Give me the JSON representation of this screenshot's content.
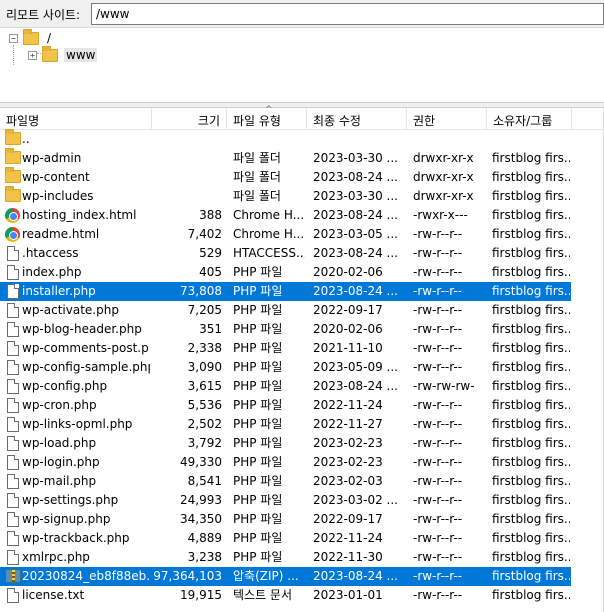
{
  "sitebar": {
    "label": "리모트 사이트:",
    "path": "/www"
  },
  "tree": {
    "root": {
      "label": "/",
      "expander": "−"
    },
    "child": {
      "label": "www",
      "expander": "+"
    }
  },
  "columns": [
    "파일명",
    "크기",
    "파일 유형",
    "최종 수정",
    "권한",
    "소유자/그룹"
  ],
  "rows": [
    {
      "icon": "folder-icon",
      "name": "..",
      "size": "",
      "type": "",
      "date": "",
      "perm": "",
      "owner": ""
    },
    {
      "icon": "folder-icon",
      "name": "wp-admin",
      "size": "",
      "type": "파일 폴더",
      "date": "2023-03-30 ...",
      "perm": "drwxr-xr-x",
      "owner": "firstblog firs..."
    },
    {
      "icon": "folder-icon",
      "name": "wp-content",
      "size": "",
      "type": "파일 폴더",
      "date": "2023-08-24 ...",
      "perm": "drwxr-xr-x",
      "owner": "firstblog firs..."
    },
    {
      "icon": "folder-icon",
      "name": "wp-includes",
      "size": "",
      "type": "파일 폴더",
      "date": "2023-03-30 ...",
      "perm": "drwxr-xr-x",
      "owner": "firstblog firs..."
    },
    {
      "icon": "chrome-icon",
      "name": "hosting_index.html",
      "size": "388",
      "type": "Chrome H...",
      "date": "2023-08-24 ...",
      "perm": "-rwxr-x---",
      "owner": "firstblog firs..."
    },
    {
      "icon": "chrome-icon",
      "name": "readme.html",
      "size": "7,402",
      "type": "Chrome H...",
      "date": "2023-03-05 ...",
      "perm": "-rw-r--r--",
      "owner": "firstblog firs..."
    },
    {
      "icon": "file-icon",
      "name": ".htaccess",
      "size": "529",
      "type": "HTACCESS...",
      "date": "2023-08-24 ...",
      "perm": "-rw-r--r--",
      "owner": "firstblog firs..."
    },
    {
      "icon": "file-icon",
      "name": "index.php",
      "size": "405",
      "type": "PHP 파일",
      "date": "2020-02-06",
      "perm": "-rw-r--r--",
      "owner": "firstblog firs..."
    },
    {
      "icon": "file-icon",
      "name": "installer.php",
      "size": "73,808",
      "type": "PHP 파일",
      "date": "2023-08-24 ...",
      "perm": "-rw-r--r--",
      "owner": "firstblog firs...",
      "selected": true
    },
    {
      "icon": "file-icon",
      "name": "wp-activate.php",
      "size": "7,205",
      "type": "PHP 파일",
      "date": "2022-09-17",
      "perm": "-rw-r--r--",
      "owner": "firstblog firs..."
    },
    {
      "icon": "file-icon",
      "name": "wp-blog-header.php",
      "size": "351",
      "type": "PHP 파일",
      "date": "2020-02-06",
      "perm": "-rw-r--r--",
      "owner": "firstblog firs..."
    },
    {
      "icon": "file-icon",
      "name": "wp-comments-post.p...",
      "size": "2,338",
      "type": "PHP 파일",
      "date": "2021-11-10",
      "perm": "-rw-r--r--",
      "owner": "firstblog firs..."
    },
    {
      "icon": "file-icon",
      "name": "wp-config-sample.php",
      "size": "3,090",
      "type": "PHP 파일",
      "date": "2023-05-09 ...",
      "perm": "-rw-r--r--",
      "owner": "firstblog firs..."
    },
    {
      "icon": "file-icon",
      "name": "wp-config.php",
      "size": "3,615",
      "type": "PHP 파일",
      "date": "2023-08-24 ...",
      "perm": "-rw-rw-rw-",
      "owner": "firstblog firs..."
    },
    {
      "icon": "file-icon",
      "name": "wp-cron.php",
      "size": "5,536",
      "type": "PHP 파일",
      "date": "2022-11-24",
      "perm": "-rw-r--r--",
      "owner": "firstblog firs..."
    },
    {
      "icon": "file-icon",
      "name": "wp-links-opml.php",
      "size": "2,502",
      "type": "PHP 파일",
      "date": "2022-11-27",
      "perm": "-rw-r--r--",
      "owner": "firstblog firs..."
    },
    {
      "icon": "file-icon",
      "name": "wp-load.php",
      "size": "3,792",
      "type": "PHP 파일",
      "date": "2023-02-23",
      "perm": "-rw-r--r--",
      "owner": "firstblog firs..."
    },
    {
      "icon": "file-icon",
      "name": "wp-login.php",
      "size": "49,330",
      "type": "PHP 파일",
      "date": "2023-02-23",
      "perm": "-rw-r--r--",
      "owner": "firstblog firs..."
    },
    {
      "icon": "file-icon",
      "name": "wp-mail.php",
      "size": "8,541",
      "type": "PHP 파일",
      "date": "2023-02-03",
      "perm": "-rw-r--r--",
      "owner": "firstblog firs..."
    },
    {
      "icon": "file-icon",
      "name": "wp-settings.php",
      "size": "24,993",
      "type": "PHP 파일",
      "date": "2023-03-02 ...",
      "perm": "-rw-r--r--",
      "owner": "firstblog firs..."
    },
    {
      "icon": "file-icon",
      "name": "wp-signup.php",
      "size": "34,350",
      "type": "PHP 파일",
      "date": "2022-09-17",
      "perm": "-rw-r--r--",
      "owner": "firstblog firs..."
    },
    {
      "icon": "file-icon",
      "name": "wp-trackback.php",
      "size": "4,889",
      "type": "PHP 파일",
      "date": "2022-11-24",
      "perm": "-rw-r--r--",
      "owner": "firstblog firs..."
    },
    {
      "icon": "file-icon",
      "name": "xmlrpc.php",
      "size": "3,238",
      "type": "PHP 파일",
      "date": "2022-11-30",
      "perm": "-rw-r--r--",
      "owner": "firstblog firs..."
    },
    {
      "icon": "zip-icon",
      "name": "20230824_eb8f88eb...",
      "size": "97,364,103",
      "type": "압축(ZIP) ...",
      "date": "2023-08-24 ...",
      "perm": "-rw-r--r--",
      "owner": "firstblog firs...",
      "selected": true
    },
    {
      "icon": "file-icon",
      "name": "license.txt",
      "size": "19,915",
      "type": "텍스트 문서",
      "date": "2023-01-01",
      "perm": "-rw-r--r--",
      "owner": "firstblog firs..."
    }
  ]
}
